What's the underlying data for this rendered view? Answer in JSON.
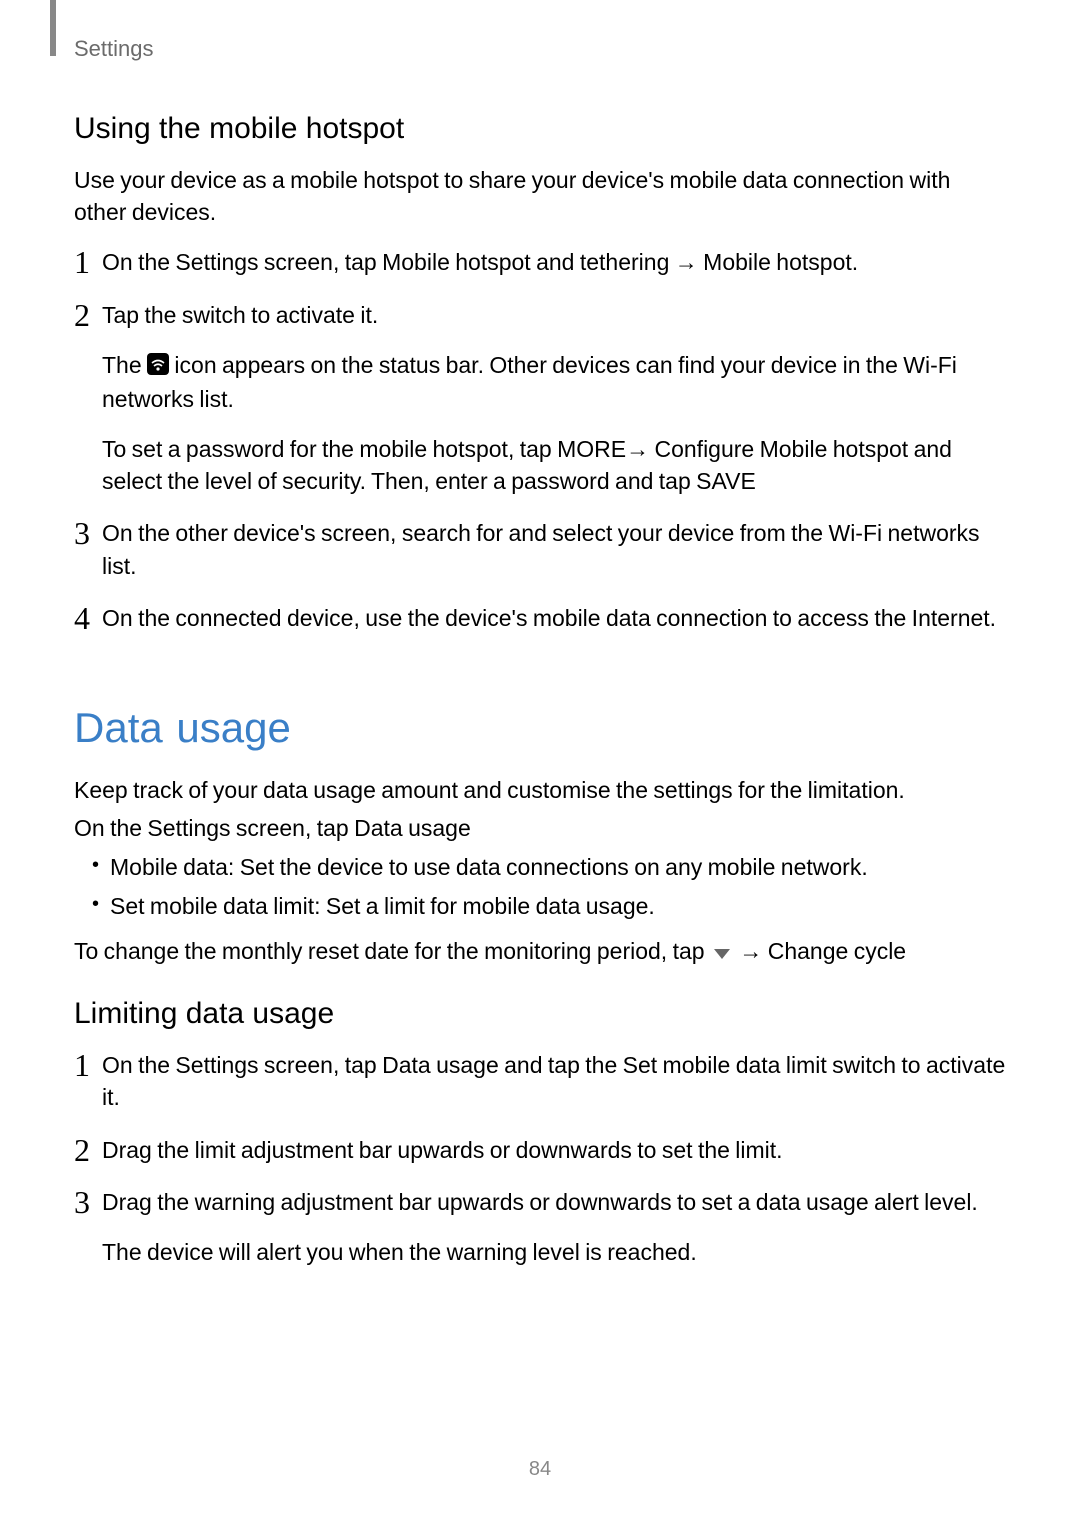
{
  "header": {
    "label": "Settings"
  },
  "section1": {
    "heading": "Using the mobile hotspot",
    "intro": "Use your device as a mobile hotspot to share your device's mobile data connection with other devices.",
    "steps": [
      {
        "num": "1",
        "p1a": "On the Settings screen, tap ",
        "p1b": "Mobile hotspot and tethering",
        "p1c": " → ",
        "p1d": "Mobile hotspot",
        "p1e": "."
      },
      {
        "num": "2",
        "p1": "Tap the switch to activate it.",
        "p2a": "The ",
        "p2b": " icon appears on the status bar. Other devices can find your device in the Wi-Fi networks list.",
        "p3a": "To set a password for the mobile hotspot, tap ",
        "p3b": "MORE",
        "p3c": "→ ",
        "p3d": "Configure Mobile hotspot",
        "p3e": " and select the level of security. Then, enter a password and tap ",
        "p3f": "SAVE"
      },
      {
        "num": "3",
        "p1": "On the other device's screen, search for and select your device from the Wi-Fi networks list."
      },
      {
        "num": "4",
        "p1": "On the connected device, use the device's mobile data connection to access the Internet."
      }
    ]
  },
  "section2": {
    "heading": "Data usage",
    "intro": "Keep track of your data usage amount and customise the settings for the limitation.",
    "nav_a": "On the Settings screen, tap ",
    "nav_b": "Data usage",
    "bullets": [
      {
        "label": "Mobile data",
        "desc": ": Set the device to use data connections on any mobile network."
      },
      {
        "label": "Set mobile data limit",
        "desc": ": Set a limit for mobile data usage."
      }
    ],
    "cycle_a": "To change the monthly reset date for the monitoring period, tap ",
    "cycle_b": " → ",
    "cycle_c": "Change cycle"
  },
  "section3": {
    "heading": "Limiting data usage",
    "steps": [
      {
        "num": "1",
        "p1a": "On the Settings screen, tap ",
        "p1b": "Data usage",
        "p1c": " and tap the ",
        "p1d": "Set mobile data limit",
        "p1e": " switch to activate it."
      },
      {
        "num": "2",
        "p1": "Drag the limit adjustment bar upwards or downwards to set the limit."
      },
      {
        "num": "3",
        "p1": "Drag the warning adjustment bar upwards or downwards to set a data usage alert level.",
        "p2": "The device will alert you when the warning level is reached."
      }
    ]
  },
  "page_number": "84"
}
